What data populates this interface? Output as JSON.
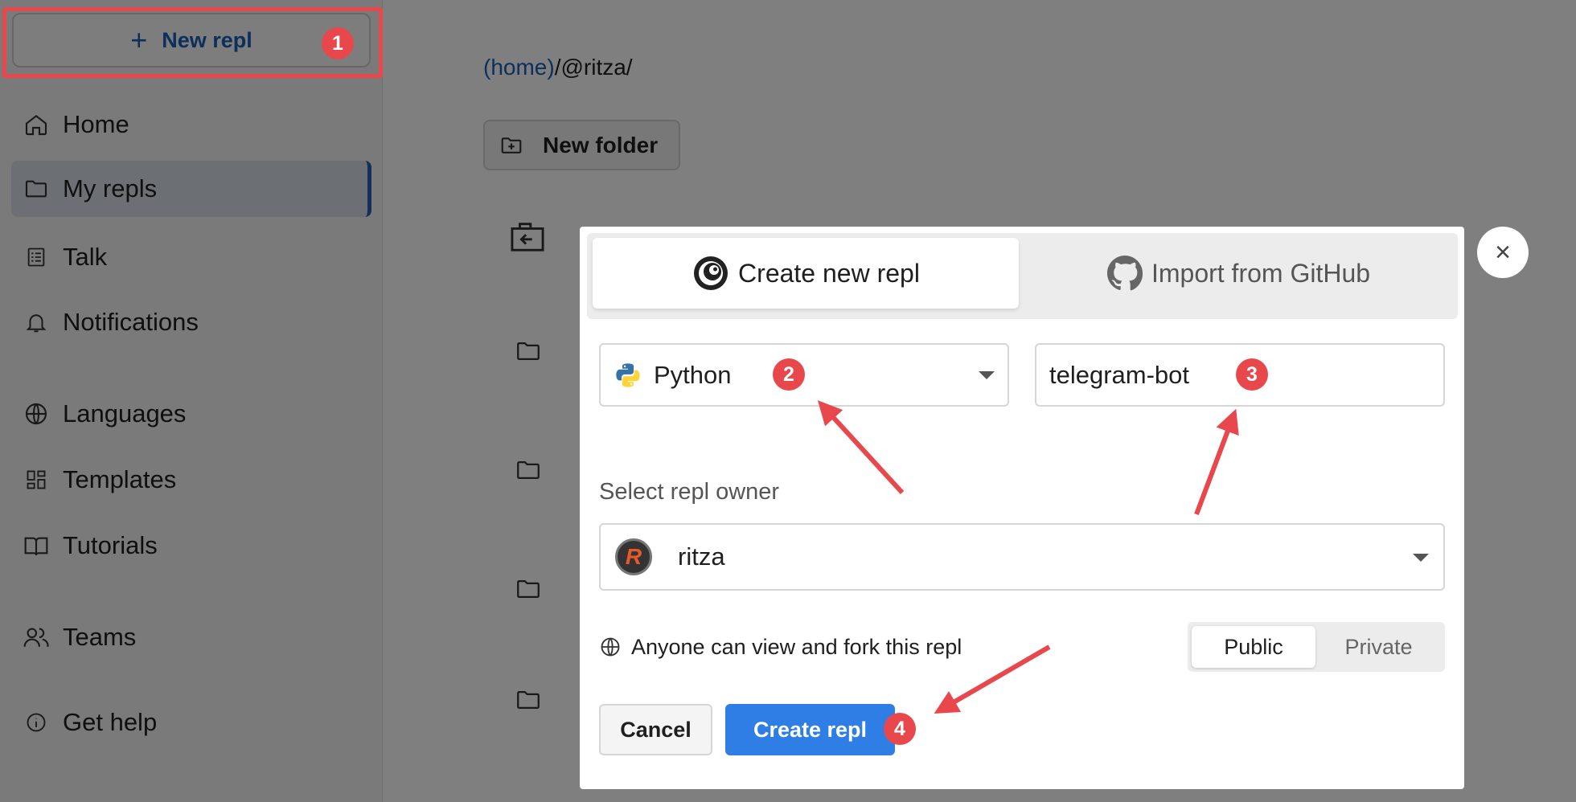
{
  "sidebar": {
    "new_repl_icon": "plus-icon",
    "new_repl_label": "New repl",
    "items": [
      {
        "label": "Home",
        "icon": "home-icon"
      },
      {
        "label": "My repls",
        "icon": "folder-icon",
        "active": true
      },
      {
        "label": "Talk",
        "icon": "talk-icon"
      },
      {
        "label": "Notifications",
        "icon": "bell-icon"
      },
      {
        "label": "Languages",
        "icon": "globe-icon"
      },
      {
        "label": "Templates",
        "icon": "templates-icon"
      },
      {
        "label": "Tutorials",
        "icon": "book-icon"
      },
      {
        "label": "Teams",
        "icon": "users-icon"
      },
      {
        "label": "Get help",
        "icon": "info-icon"
      }
    ]
  },
  "main": {
    "breadcrumb_home": "(home)",
    "breadcrumb_rest": "/@ritza/",
    "new_folder_label": "New folder"
  },
  "modal": {
    "tabs": [
      {
        "label": "Create new repl",
        "icon": "replit-logo-icon",
        "active": true
      },
      {
        "label": "Import from GitHub",
        "icon": "github-icon",
        "active": false
      }
    ],
    "language": {
      "value": "Python",
      "icon": "python-icon"
    },
    "name_input": {
      "value": "telegram-bot"
    },
    "owner_label": "Select repl owner",
    "owner": {
      "name": "ritza",
      "avatar_letter": "R"
    },
    "visibility_text": "Anyone can view and fork this repl",
    "visibility_options": [
      "Public",
      "Private"
    ],
    "visibility_selected": "Public",
    "cancel_label": "Cancel",
    "create_label": "Create repl",
    "close_symbol": "×"
  },
  "steps": [
    "1",
    "2",
    "3",
    "4"
  ],
  "colors": {
    "accent": "#2f7ee6",
    "link": "#1b5fb8",
    "annotation": "#e8484c",
    "overlay": "rgba(0,0,0,0.5)"
  }
}
